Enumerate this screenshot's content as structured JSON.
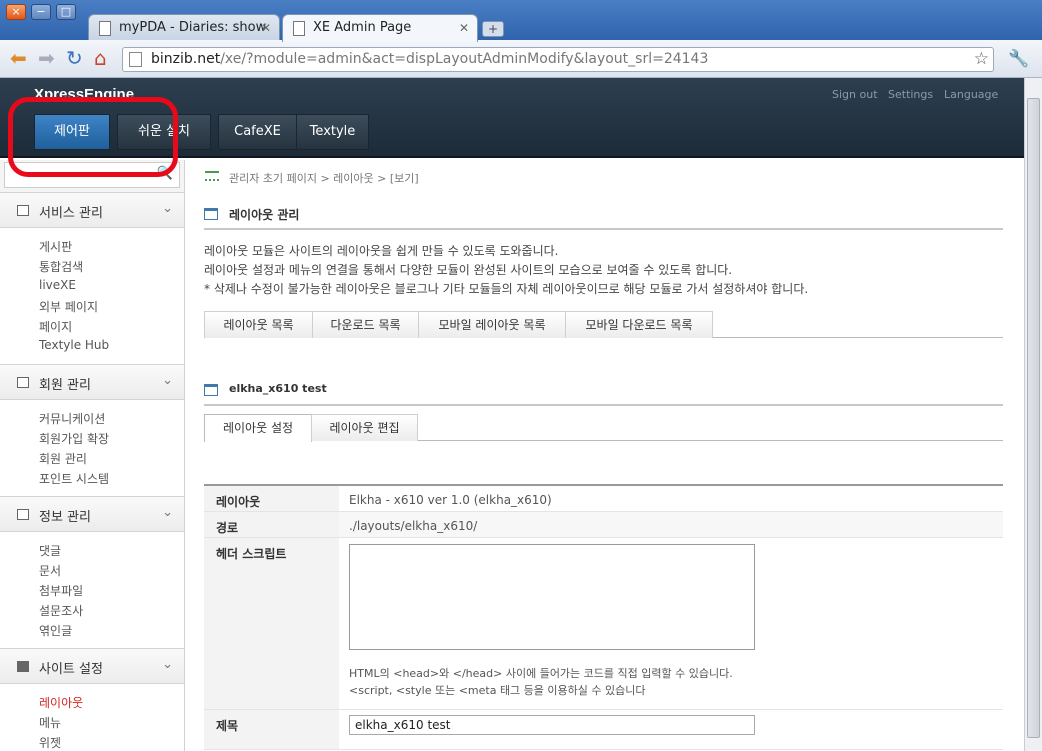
{
  "browser": {
    "tabs": [
      {
        "title": "myPDA - Diaries: show"
      },
      {
        "title": "XE Admin Page"
      }
    ],
    "url_host": "binzib.net",
    "url_path": "/xe/?module=admin&act=dispLayoutAdminModify&layout_srl=24143",
    "window_buttons": [
      "×",
      "−",
      "□"
    ],
    "new_tab_icon": "+",
    "nav_icons": [
      "back-icon",
      "forward-icon",
      "reload-icon",
      "home-icon"
    ]
  },
  "header": {
    "logo": "XpressEngine",
    "top_links": [
      "Sign out",
      "Settings",
      "Language"
    ],
    "gnb": [
      "제어판",
      "쉬운 설치",
      "CafeXE",
      "Textyle"
    ]
  },
  "sidebar": {
    "search_icon": "🔍",
    "sections": [
      {
        "title": "서비스 관리",
        "items": [
          "게시판",
          "통합검색",
          "liveXE",
          "외부 페이지",
          "페이지",
          "Textyle Hub"
        ]
      },
      {
        "title": "회원 관리",
        "items": [
          "커뮤니케이션",
          "회원가입 확장",
          "회원 관리",
          "포인트 시스템"
        ]
      },
      {
        "title": "정보 관리",
        "items": [
          "댓글",
          "문서",
          "첨부파일",
          "설문조사",
          "엮인글"
        ]
      },
      {
        "title": "사이트 설정",
        "items": [
          "레이아웃",
          "메뉴",
          "위젯"
        ]
      }
    ],
    "chevron": "⌄"
  },
  "main": {
    "breadcrumb": "관리자 초기 페이지 > 레이아웃 > [보기]",
    "section_title": "레이아웃 관리",
    "desc": [
      "레이아웃 모듈은 사이트의 레이아웃을 쉽게 만들 수 있도록 도와줍니다.",
      "레이아웃 설정과 메뉴의 연결을 통해서 다양한 모듈이 완성된 사이트의 모습으로 보여줄 수 있도록 합니다.",
      "* 삭제나 수정이 불가능한 레이아웃은 블로그나 기타 모듈들의 자체 레이아웃이므로 해당 모듈로 가서 설정하셔야 합니다."
    ],
    "tabs": [
      "레이아웃 목록",
      "다운로드 목록",
      "모바일 레이아웃 목록",
      "모바일 다운로드 목록"
    ],
    "layout_title": "elkha_x610 test",
    "sub_tabs": [
      "레이아웃 설정",
      "레이아웃 편집"
    ],
    "table": {
      "layout_label": "레이아웃",
      "layout_value": "Elkha - x610 ver 1.0 (elkha_x610)",
      "path_label": "경로",
      "path_value": "./layouts/elkha_x610/",
      "header_script_label": "헤더 스크립트",
      "header_script_value": "",
      "hint1": "HTML의 <head>와 </head> 사이에 들어가는 코드를 직접 입력할 수 있습니다.",
      "hint2": "<script, <style 또는 <meta 태그 등을 이용하실 수 있습니다",
      "title_label": "제목",
      "title_value": "elkha_x610 test"
    }
  }
}
